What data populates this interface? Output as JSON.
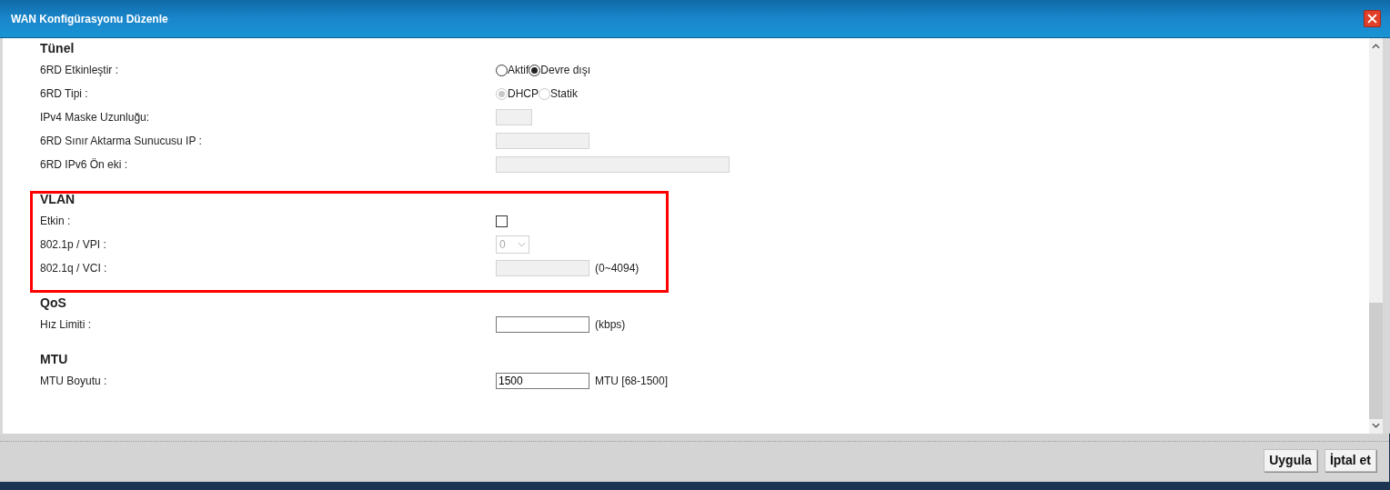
{
  "window": {
    "title": "WAN Konfigürasyonu Düzenle"
  },
  "sections": [
    {
      "title": "Tünel",
      "rows": [
        {
          "label": "6RD Etkinleştir :",
          "kind": "radio",
          "options": [
            {
              "label": "Aktif",
              "selected": false,
              "disabled": false
            },
            {
              "label": "Devre dışı",
              "selected": true,
              "disabled": false
            }
          ]
        },
        {
          "label": "6RD Tipi :",
          "kind": "radio",
          "options": [
            {
              "label": "DHCP",
              "selected": true,
              "disabled": true
            },
            {
              "label": "Statik",
              "selected": false,
              "disabled": true
            }
          ]
        },
        {
          "label": "IPv4 Maske Uzunluğu:",
          "kind": "text",
          "disabled": true
        },
        {
          "label": "6RD Sınır Aktarma Sunucusu IP :",
          "kind": "text",
          "disabled": true
        },
        {
          "label": "6RD IPv6 Ön eki :",
          "kind": "text",
          "disabled": true
        }
      ]
    },
    {
      "title": "VLAN",
      "rows": [
        {
          "label": "Etkin :",
          "kind": "checkbox",
          "checked": false
        },
        {
          "label": "802.1p / VPI :",
          "kind": "select",
          "value": "0",
          "disabled": true
        },
        {
          "label": "802.1q / VCI :",
          "kind": "text",
          "disabled": true,
          "unit": "(0~4094)"
        }
      ]
    },
    {
      "title": "QoS",
      "rows": [
        {
          "label": "Hız Limiti :",
          "kind": "text",
          "disabled": false,
          "unit": "(kbps)"
        }
      ]
    },
    {
      "title": "MTU",
      "rows": [
        {
          "label": "MTU Boyutu :",
          "kind": "text",
          "disabled": false,
          "value": "1500",
          "unit": "MTU [68-1500]"
        }
      ]
    }
  ],
  "buttons": [
    "Uygula",
    "İptal et"
  ]
}
